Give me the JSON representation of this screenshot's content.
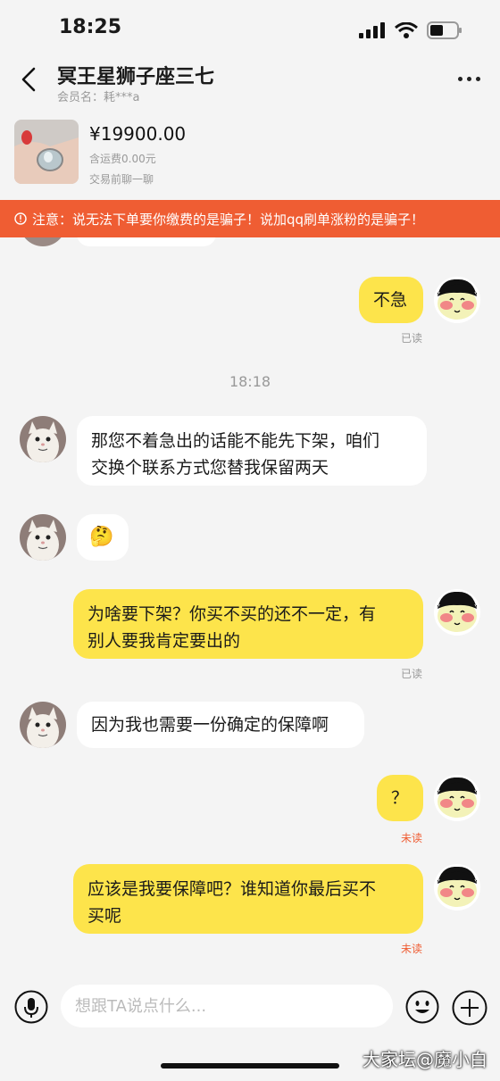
{
  "status_bar": {
    "time": "18:25"
  },
  "header": {
    "title": "冥王星狮子座三七",
    "member": "会员名：耗***a"
  },
  "product": {
    "price": "¥19900.00",
    "shipping": "含运费0.00元",
    "note": "交易前聊一聊"
  },
  "warning": {
    "text": "注意：说无法下单要你缴费的是骗子！说加qq刷单涨粉的是骗子！"
  },
  "chat": {
    "m1": {
      "text": "不急",
      "status": "已读"
    },
    "timestamp": "18:18",
    "m2": {
      "line1": "那您不着急出的话能不能先下架，咱们",
      "line2": "交换个联系方式您替我保留两天"
    },
    "m3": {
      "emoji": "🤔"
    },
    "m4": {
      "line1": "为啥要下架？你买不买的还不一定，有",
      "line2": "别人要我肯定要出的",
      "status": "已读"
    },
    "m5": {
      "text": "因为我也需要一份确定的保障啊"
    },
    "m6": {
      "text": "？",
      "status": "未读"
    },
    "m7": {
      "line1": "应该是我要保障吧？谁知道你最后买不",
      "line2": "买呢",
      "status": "未读"
    }
  },
  "input": {
    "placeholder": "想跟TA说点什么..."
  },
  "watermark": "大家坛@魔小白",
  "colors": {
    "accent": "#fde44b",
    "warning": "#ef5d33",
    "unread": "#ef5d33"
  }
}
